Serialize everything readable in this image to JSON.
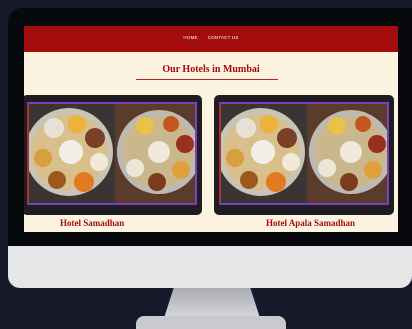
{
  "nav": {
    "items": [
      "HOME",
      "CONTACT US"
    ]
  },
  "section": {
    "title": "Our Hotels in Mumbai"
  },
  "hotels": [
    {
      "name": "Hotel Samadhan"
    },
    {
      "name": "Hotel Apala Samadhan"
    }
  ],
  "colors": {
    "brand_red": "#a30c0c",
    "page_bg": "#fdf3e1",
    "card_bg": "#1e1e22",
    "frame_purple": "#7b3fbf"
  }
}
